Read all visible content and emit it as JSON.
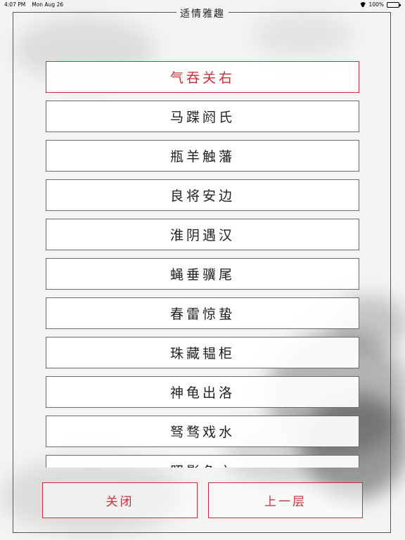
{
  "status_bar": {
    "time": "4:07 PM",
    "date": "Mon Aug 26",
    "battery": "100%",
    "icons": [
      "wifi-icon",
      "battery-icon"
    ]
  },
  "page": {
    "title": "适情雅趣"
  },
  "list": {
    "selected_index": 0,
    "items": [
      "气吞关右",
      "马蹀阏氏",
      "瓶羊触藩",
      "良将安边",
      "淮阴遇汉",
      "蝇垂骥尾",
      "春雷惊蛰",
      "珠藏韫柜",
      "神龟出洛",
      "驽骛戏水",
      "照影鱼之"
    ]
  },
  "buttons": {
    "close": "关闭",
    "up": "上一层"
  },
  "colors": {
    "accent": "#c8303a",
    "text": "#222222",
    "border": "#6a6a6a",
    "background": "#f4f4f2"
  }
}
